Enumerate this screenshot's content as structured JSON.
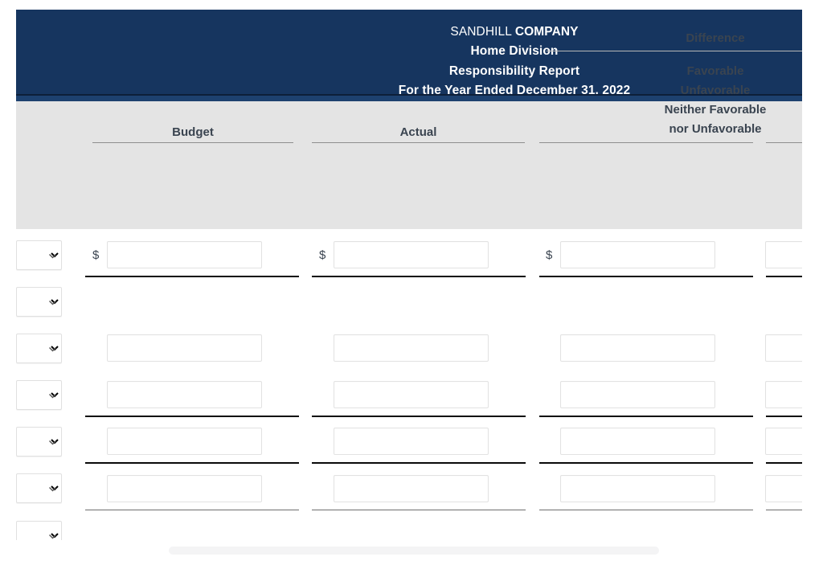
{
  "report": {
    "company_prefix": "SANDHILL ",
    "company_bold": "COMPANY",
    "division": "Home Division",
    "report_type": "Responsibility Report",
    "period": "For the Year Ended December 31, 2022"
  },
  "columns": {
    "budget": "Budget",
    "actual": "Actual",
    "difference": "Difference",
    "diff_note_line1": "Favorable",
    "diff_note_line2": "Unfavorable",
    "diff_note_line3": "Neither Favorable",
    "diff_note_line4": "nor Unfavorable"
  },
  "symbols": {
    "dollar": "$"
  },
  "rows": [
    {
      "name": "row-1",
      "select_value": "",
      "has_dollar": true,
      "budget": "",
      "actual": "",
      "difference": "",
      "fav": ""
    },
    {
      "name": "row-2",
      "select_value": "",
      "has_dollar": false,
      "budget": null,
      "actual": null,
      "difference": null,
      "fav": null
    },
    {
      "name": "row-3",
      "select_value": "",
      "has_dollar": false,
      "budget": "",
      "actual": "",
      "difference": "",
      "fav": ""
    },
    {
      "name": "row-4",
      "select_value": "",
      "has_dollar": false,
      "budget": "",
      "actual": "",
      "difference": "",
      "fav": ""
    },
    {
      "name": "row-5",
      "select_value": "",
      "has_dollar": false,
      "budget": "",
      "actual": "",
      "difference": "",
      "fav": ""
    },
    {
      "name": "row-6",
      "select_value": "",
      "has_dollar": false,
      "budget": "",
      "actual": "",
      "difference": "",
      "fav": ""
    },
    {
      "name": "row-7",
      "select_value": "",
      "has_dollar": false,
      "budget": null,
      "actual": null,
      "difference": null,
      "fav": null
    }
  ],
  "colors": {
    "banner_bg": "#16355f",
    "header_band_bg": "#e4e4e4",
    "header_text": "#3a4450",
    "rule": "#0a0a0a",
    "page_bg": "#ffffff"
  },
  "scrollbar": {
    "orientation": "horizontal",
    "thumb_visible": true
  }
}
